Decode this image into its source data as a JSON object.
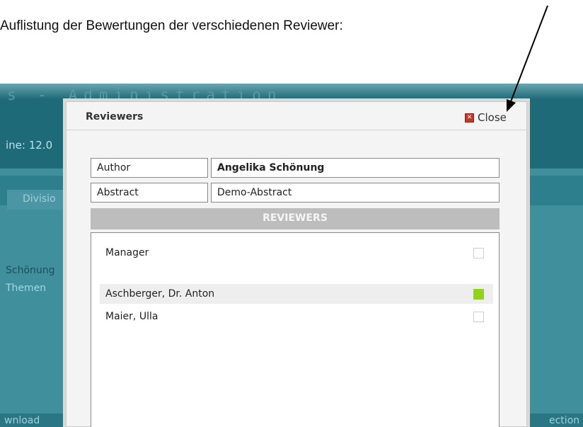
{
  "caption": "Auflistung der Bewertungen der verschiedenen Reviewer:",
  "background_app": {
    "title": "s  -  Administration",
    "deadline_fragment": "ine: 12.0",
    "nav_tab_fragment": "Divisio",
    "list_fragment_1": "Schönung",
    "list_fragment_2": "Themen",
    "footer_left_fragment": "wnload",
    "footer_right_fragment": "ection"
  },
  "modal": {
    "title": "Reviewers",
    "close_label": "Close",
    "close_icon": "close-x-icon",
    "author_label": "Author",
    "author_value": "Angelika Schönung",
    "abstract_label": "Abstract",
    "abstract_value": "Demo-Abstract",
    "reviewers_header": "REVIEWERS",
    "reviewers": [
      {
        "name": "Manager",
        "reviewed": false
      },
      {
        "name": "Aschberger, Dr. Anton",
        "reviewed": true
      },
      {
        "name": "Maier, Ulla",
        "reviewed": false
      }
    ]
  },
  "colors": {
    "reviewed_green": "#8fd41a",
    "app_teal": "#3f8f9d",
    "section_header_gray": "#bdbdbd",
    "close_red": "#c0392b"
  }
}
